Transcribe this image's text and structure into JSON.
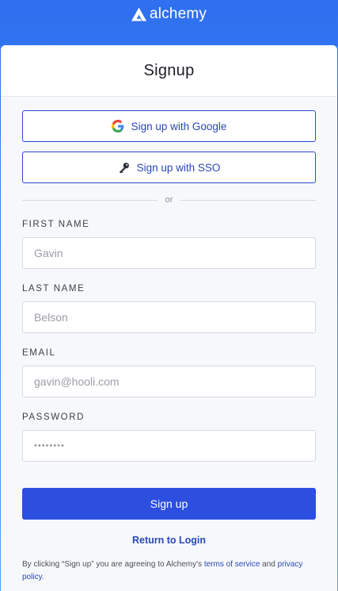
{
  "brand": {
    "name": "alchemy",
    "logo_icon": "alchemy-logo-icon"
  },
  "card": {
    "title": "Signup"
  },
  "oauth": {
    "google_label": "Sign up with Google",
    "google_icon": "google-icon",
    "sso_label": "Sign up with SSO",
    "sso_icon": "key-icon"
  },
  "divider": {
    "text": "or"
  },
  "form": {
    "first_name": {
      "label": "FIRST NAME",
      "placeholder": "Gavin",
      "value": ""
    },
    "last_name": {
      "label": "LAST NAME",
      "placeholder": "Belson",
      "value": ""
    },
    "email": {
      "label": "EMAIL",
      "placeholder": "gavin@hooli.com",
      "value": ""
    },
    "password": {
      "label": "PASSWORD",
      "placeholder": "••••••••",
      "value": ""
    }
  },
  "submit_label": "Sign up",
  "return_link": "Return to Login",
  "legal": {
    "prefix": "By clicking “Sign up” you are agreeing to Alchemy's ",
    "terms_link": "terms of service",
    "middle": " and ",
    "privacy_link": "privacy policy",
    "suffix": "."
  },
  "colors": {
    "accent": "#2c4fe0",
    "link": "#2a47b8",
    "header_gradient_top": "#2f6ff0",
    "header_gradient_bottom": "#47a3fb"
  }
}
